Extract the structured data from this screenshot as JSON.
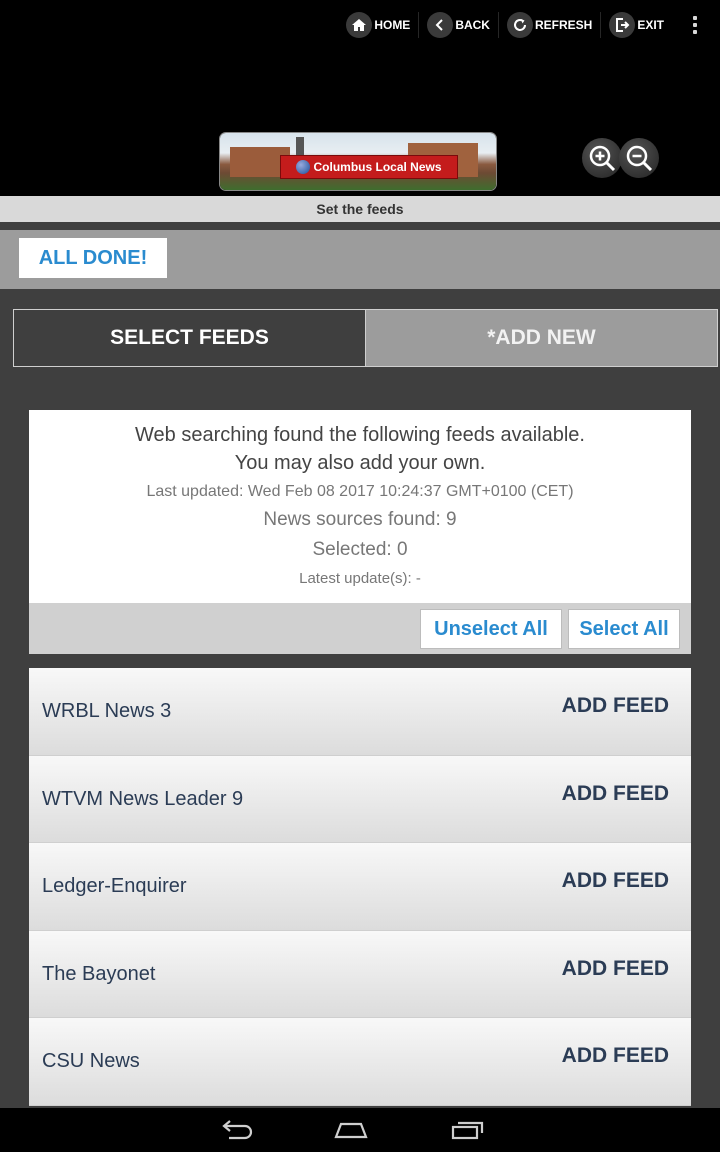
{
  "nav": {
    "home": "HOME",
    "back": "BACK",
    "refresh": "REFRESH",
    "exit": "EXIT",
    "menu_icon": "overflow-menu-icon"
  },
  "logo": {
    "title": "Columbus Local News"
  },
  "page": {
    "subtitle": "Set the feeds"
  },
  "actions": {
    "done": "ALL DONE!"
  },
  "tabs": [
    {
      "label": "SELECT FEEDS",
      "active": true
    },
    {
      "label": "*ADD NEW",
      "active": false
    }
  ],
  "info": {
    "line1": "Web searching found the following feeds available.",
    "line2": "You may also add your own.",
    "last_updated": "Last updated: Wed Feb 08 2017 10:24:37 GMT+0100 (CET)",
    "sources_found": "News sources found: 9",
    "selected": "Selected: 0",
    "latest_updates": "Latest update(s): -"
  },
  "selection": {
    "unselect_all": "Unselect All",
    "select_all": "Select All"
  },
  "feeds": [
    {
      "name": "WRBL News 3",
      "action": "ADD FEED"
    },
    {
      "name": "WTVM News Leader 9",
      "action": "ADD FEED"
    },
    {
      "name": "Ledger-Enquirer",
      "action": "ADD FEED"
    },
    {
      "name": "The Bayonet",
      "action": "ADD FEED"
    },
    {
      "name": "CSU News",
      "action": "ADD FEED"
    }
  ],
  "colors": {
    "accent": "#2a8bcf",
    "feed_text": "#2b3c55",
    "background": "#3f3f3f"
  }
}
